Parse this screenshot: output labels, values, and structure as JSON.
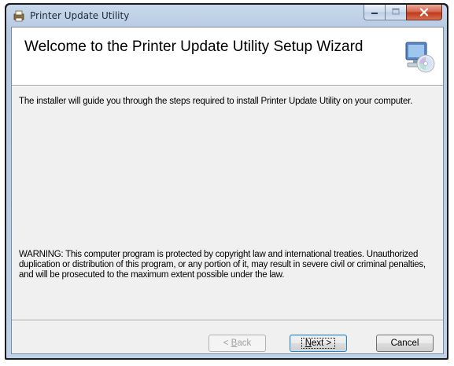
{
  "window": {
    "title": "Printer Update Utility"
  },
  "icons": {
    "app": "printer-installer-icon",
    "banner": "computer-cd-icon",
    "minimize": "minimize-icon",
    "maximize": "maximize-icon",
    "close": "close-icon"
  },
  "banner": {
    "title": "Welcome to the Printer Update Utility Setup Wizard"
  },
  "body": {
    "description": "The installer will guide you through the steps required to install Printer Update Utility on your computer.",
    "warning": "WARNING: This computer program is protected by copyright law and international treaties. Unauthorized duplication or distribution of this program, or any portion of it, may result in severe civil or criminal penalties, and will be prosecuted to the maximum extent possible under the law."
  },
  "buttons": {
    "back_prefix": "< ",
    "back_accel": "B",
    "back_rest": "ack",
    "next_accel": "N",
    "next_rest": "ext >",
    "cancel": "Cancel"
  },
  "colors": {
    "close_button": "#c0391f",
    "client_background": "#f0f0f0",
    "banner_background": "#ffffff"
  }
}
